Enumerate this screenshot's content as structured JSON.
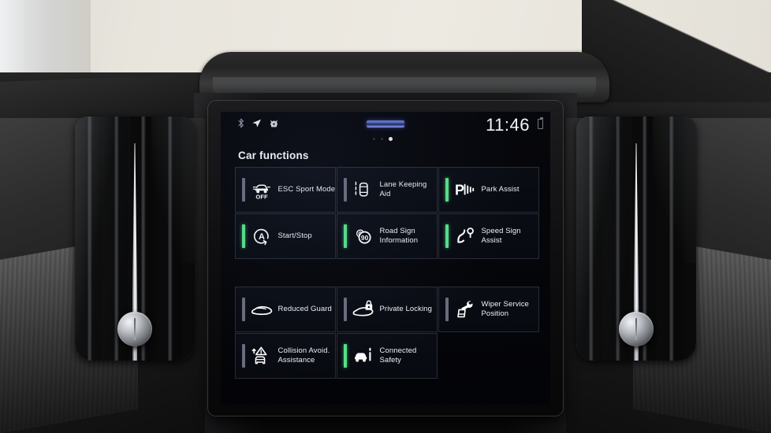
{
  "status_bar": {
    "icons": [
      "bluetooth-icon",
      "navigation-arrow-icon",
      "connectivity-icon"
    ],
    "time": "11:46",
    "grip_handle": "drag-handle",
    "page_dots": {
      "count": 3,
      "active_index": 2
    }
  },
  "screen": {
    "section_title": "Car functions",
    "accent_active_color": "#56e08a",
    "accent_inactive_color": "#6b6b7d",
    "background_color": "#05060a"
  },
  "tiles_group_one": [
    {
      "label": "ESC Sport Mode",
      "icon": "esc-off-icon",
      "active": false
    },
    {
      "label": "Lane Keeping Aid",
      "icon": "lane-keeping-icon",
      "active": false
    },
    {
      "label": "Park Assist",
      "icon": "park-assist-icon",
      "active": true
    },
    {
      "label": "Start/Stop",
      "icon": "start-stop-icon",
      "active": true
    },
    {
      "label": "Road Sign Information",
      "icon": "speed-limit-90-icon",
      "active": true
    },
    {
      "label": "Speed Sign Assist",
      "icon": "speed-sign-assist-icon",
      "active": true
    }
  ],
  "tiles_group_two": [
    {
      "label": "Reduced Guard",
      "icon": "reduced-guard-icon",
      "active": false
    },
    {
      "label": "Private Locking",
      "icon": "private-locking-icon",
      "active": false
    },
    {
      "label": "Wiper Service Position",
      "icon": "wiper-service-icon",
      "active": false
    },
    {
      "label": "Collision Avoid. Assistance",
      "icon": "collision-avoid-icon",
      "active": false
    },
    {
      "label": "Connected Safety",
      "icon": "connected-safety-icon",
      "active": true
    }
  ],
  "vehicle_interior": {
    "left_vent": "air-vent-left",
    "right_vent": "air-vent-right",
    "vent_knob": "vent-control-knob"
  }
}
